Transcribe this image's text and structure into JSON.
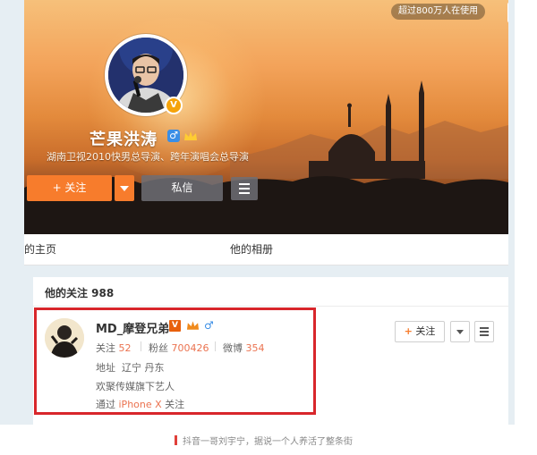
{
  "header": {
    "top_badge": "超过800万人在使用",
    "profile_name": "芒果洪涛",
    "profile_bio": "湖南卫视2010快男总导演、跨年演唱会总导演",
    "verify_badge": "V",
    "gender_symbol": "♂",
    "follow_button": "+ 关注",
    "message_button": "私信"
  },
  "tabs": {
    "home": "的主页",
    "album": "他的相册"
  },
  "follow_list": {
    "title": "他的关注 988",
    "user": {
      "name": "MD_摩登兄弟",
      "vip_badge": "V",
      "gender_symbol": "♂",
      "follows_label": "关注",
      "follows_count": "52",
      "fans_label": "粉丝",
      "fans_count": "700426",
      "weibo_label": "微博",
      "weibo_count": "354",
      "location_label": "地址",
      "location_value": "辽宁 丹东",
      "description": "欢聚传媒旗下艺人",
      "via_prefix": "通过",
      "via_device": "iPhone X",
      "via_suffix": "关注",
      "follow_button": "关注",
      "follow_plus": "+"
    }
  },
  "caption": "抖音一哥刘宇宁，据说一个人养活了整条街",
  "icons": [
    "user-avatar-icon",
    "verify-v-icon",
    "male-gender-icon",
    "crown-icon",
    "menu-icon",
    "dropdown-chevron-icon"
  ],
  "colors": {
    "accent_orange": "#f77c2c",
    "highlight_red": "#d8262b",
    "number_orange": "#eb7350",
    "male_blue": "#3a8ee6"
  }
}
